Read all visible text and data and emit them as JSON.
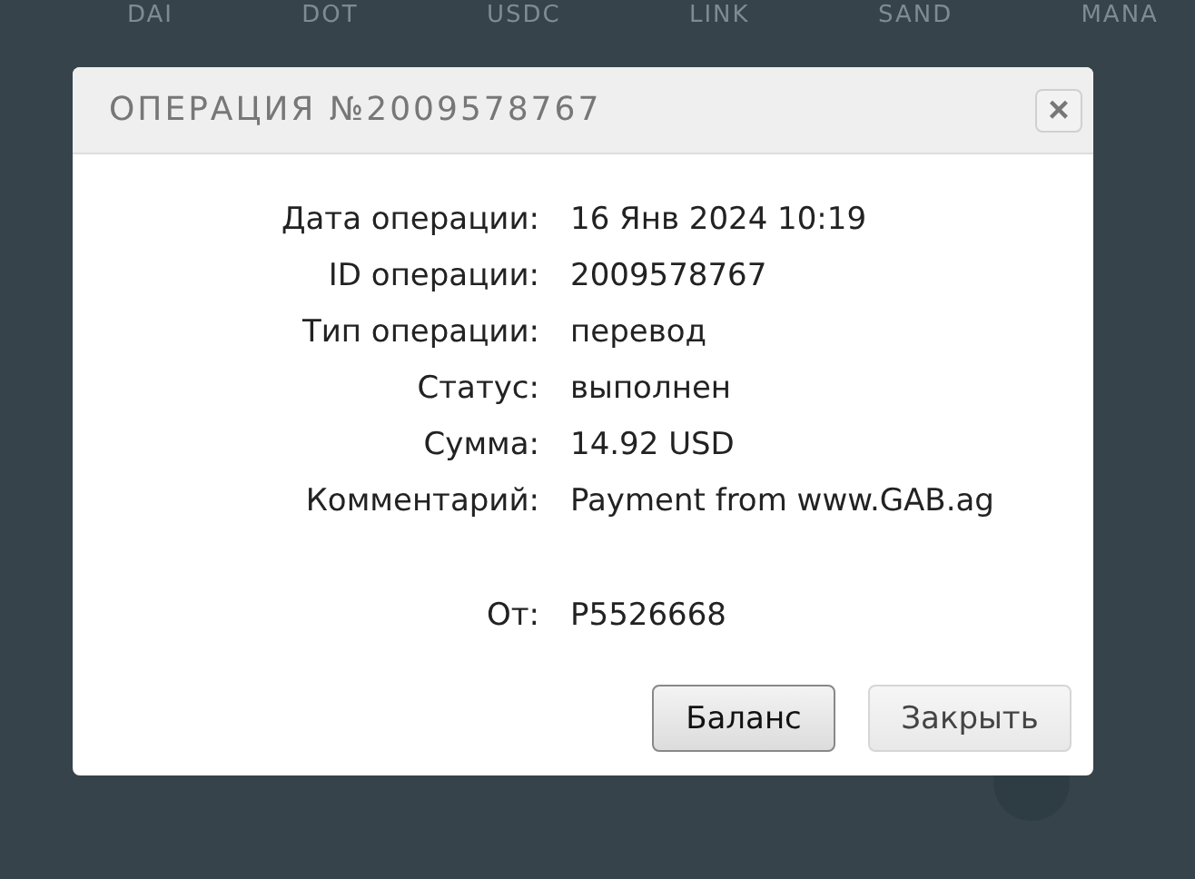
{
  "background": {
    "tickers": [
      "DAI",
      "DOT",
      "USDC",
      "LINK",
      "SAND",
      "MANA"
    ]
  },
  "dialog": {
    "title": "ОПЕРАЦИЯ №2009578767",
    "close": "×",
    "fields": [
      {
        "label": "Дата операции:",
        "value": "16 Янв 2024 10:19"
      },
      {
        "label": "ID операции:",
        "value": "2009578767"
      },
      {
        "label": "Тип операции:",
        "value": "перевод"
      },
      {
        "label": "Статус:",
        "value": "выполнен"
      },
      {
        "label": "Сумма:",
        "value": "14.92 USD"
      },
      {
        "label": "Комментарий:",
        "value": "Payment from www.GAB.ag"
      }
    ],
    "sender_fields": [
      {
        "label": "От:",
        "value": "P5526668"
      }
    ],
    "buttons": [
      {
        "label": "Баланс",
        "kind": "primary"
      },
      {
        "label": "Закрыть",
        "kind": "secondary"
      }
    ]
  }
}
